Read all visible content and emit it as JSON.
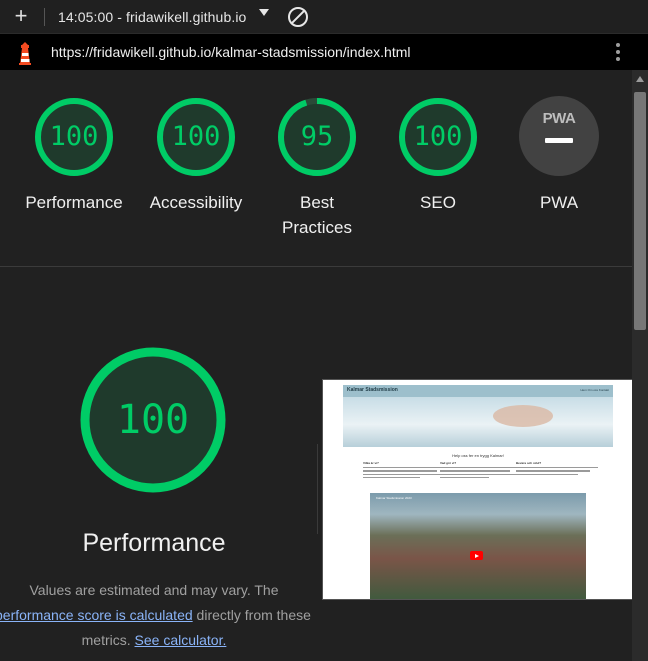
{
  "tab_bar": {
    "title": "14:05:00 - fridawikell.github.io"
  },
  "address_bar": {
    "url": "https://fridawikell.github.io/kalmar-stadsmission/index.html"
  },
  "summary": {
    "categories": [
      {
        "name": "Performance",
        "score": "100",
        "score_value": 100,
        "color": "#00cc66"
      },
      {
        "name": "Accessibility",
        "score": "100",
        "score_value": 100,
        "color": "#00cc66"
      },
      {
        "name": "Best Practices",
        "score": "95",
        "score_value": 95,
        "color": "#00cc66"
      },
      {
        "name": "SEO",
        "score": "100",
        "score_value": 100,
        "color": "#00cc66"
      },
      {
        "name": "PWA",
        "badge": "PWA"
      }
    ]
  },
  "performance": {
    "score": "100",
    "score_value": 100,
    "title": "Performance",
    "desc_line1": "Values are estimated and may vary. The",
    "desc_link1": "performance score is calculated",
    "desc_mid": " directly from these",
    "desc_line3_prefix": "metrics. ",
    "desc_link2": "See calculator."
  },
  "screenshot": {
    "site_title": "Kalmar Stadsmission",
    "nav": "Hem  Om oss  Kontakt",
    "heading": "Help oss fer en trygg Kalmar!",
    "columns": [
      "Vilka är vi?",
      "Vad gör vi?",
      "Bevara och stöd?"
    ],
    "video_title": "Kalmar Stadsmission 2023"
  },
  "colors": {
    "pass": "#00cc66",
    "background": "#212121",
    "link": "#8ab4f8"
  }
}
